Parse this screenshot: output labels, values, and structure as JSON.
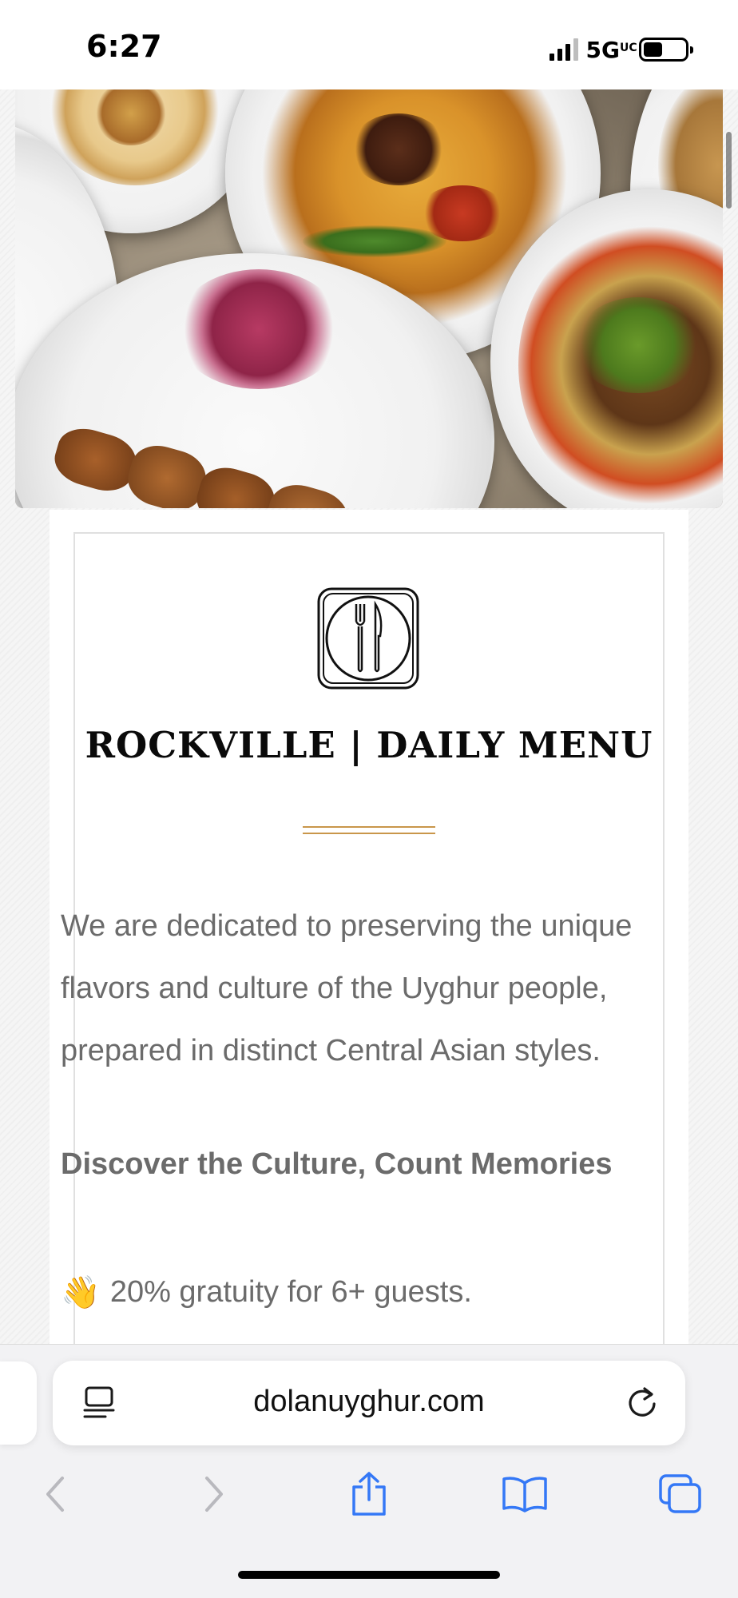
{
  "status_bar": {
    "time": "6:27",
    "network": "5G",
    "network_suffix": "UC",
    "signal_bars": 4,
    "signal_bars_active": 3,
    "battery_level_fraction": 0.45
  },
  "hero": {
    "description_icon": "food-photo"
  },
  "menu": {
    "logo_icon": "fork-knife-plate-icon",
    "heading": "ROCKVILLE | DAILY MENU",
    "intro": "We are dedicated to preserving the unique flavors and culture of the Uyghur people, prepared in distinct Central Asian styles.",
    "tagline": "Discover the Culture, Count Memories",
    "note_icon": "👋",
    "note": "20% gratuity for 6+ guests."
  },
  "browser": {
    "url": "dolanuyghur.com",
    "reader_icon": "reader-mode-icon",
    "reload_icon": "reload-icon",
    "toolbar": [
      {
        "name": "back-icon",
        "enabled": false
      },
      {
        "name": "forward-icon",
        "enabled": false
      },
      {
        "name": "share-icon",
        "enabled": true
      },
      {
        "name": "bookmarks-icon",
        "enabled": true
      },
      {
        "name": "tabs-icon",
        "enabled": true
      }
    ]
  },
  "colors": {
    "accent_blue": "#3478f6",
    "disabled_gray": "#b9b9be",
    "divider_gold": "#c9964a",
    "body_text": "#6b6b6b"
  }
}
